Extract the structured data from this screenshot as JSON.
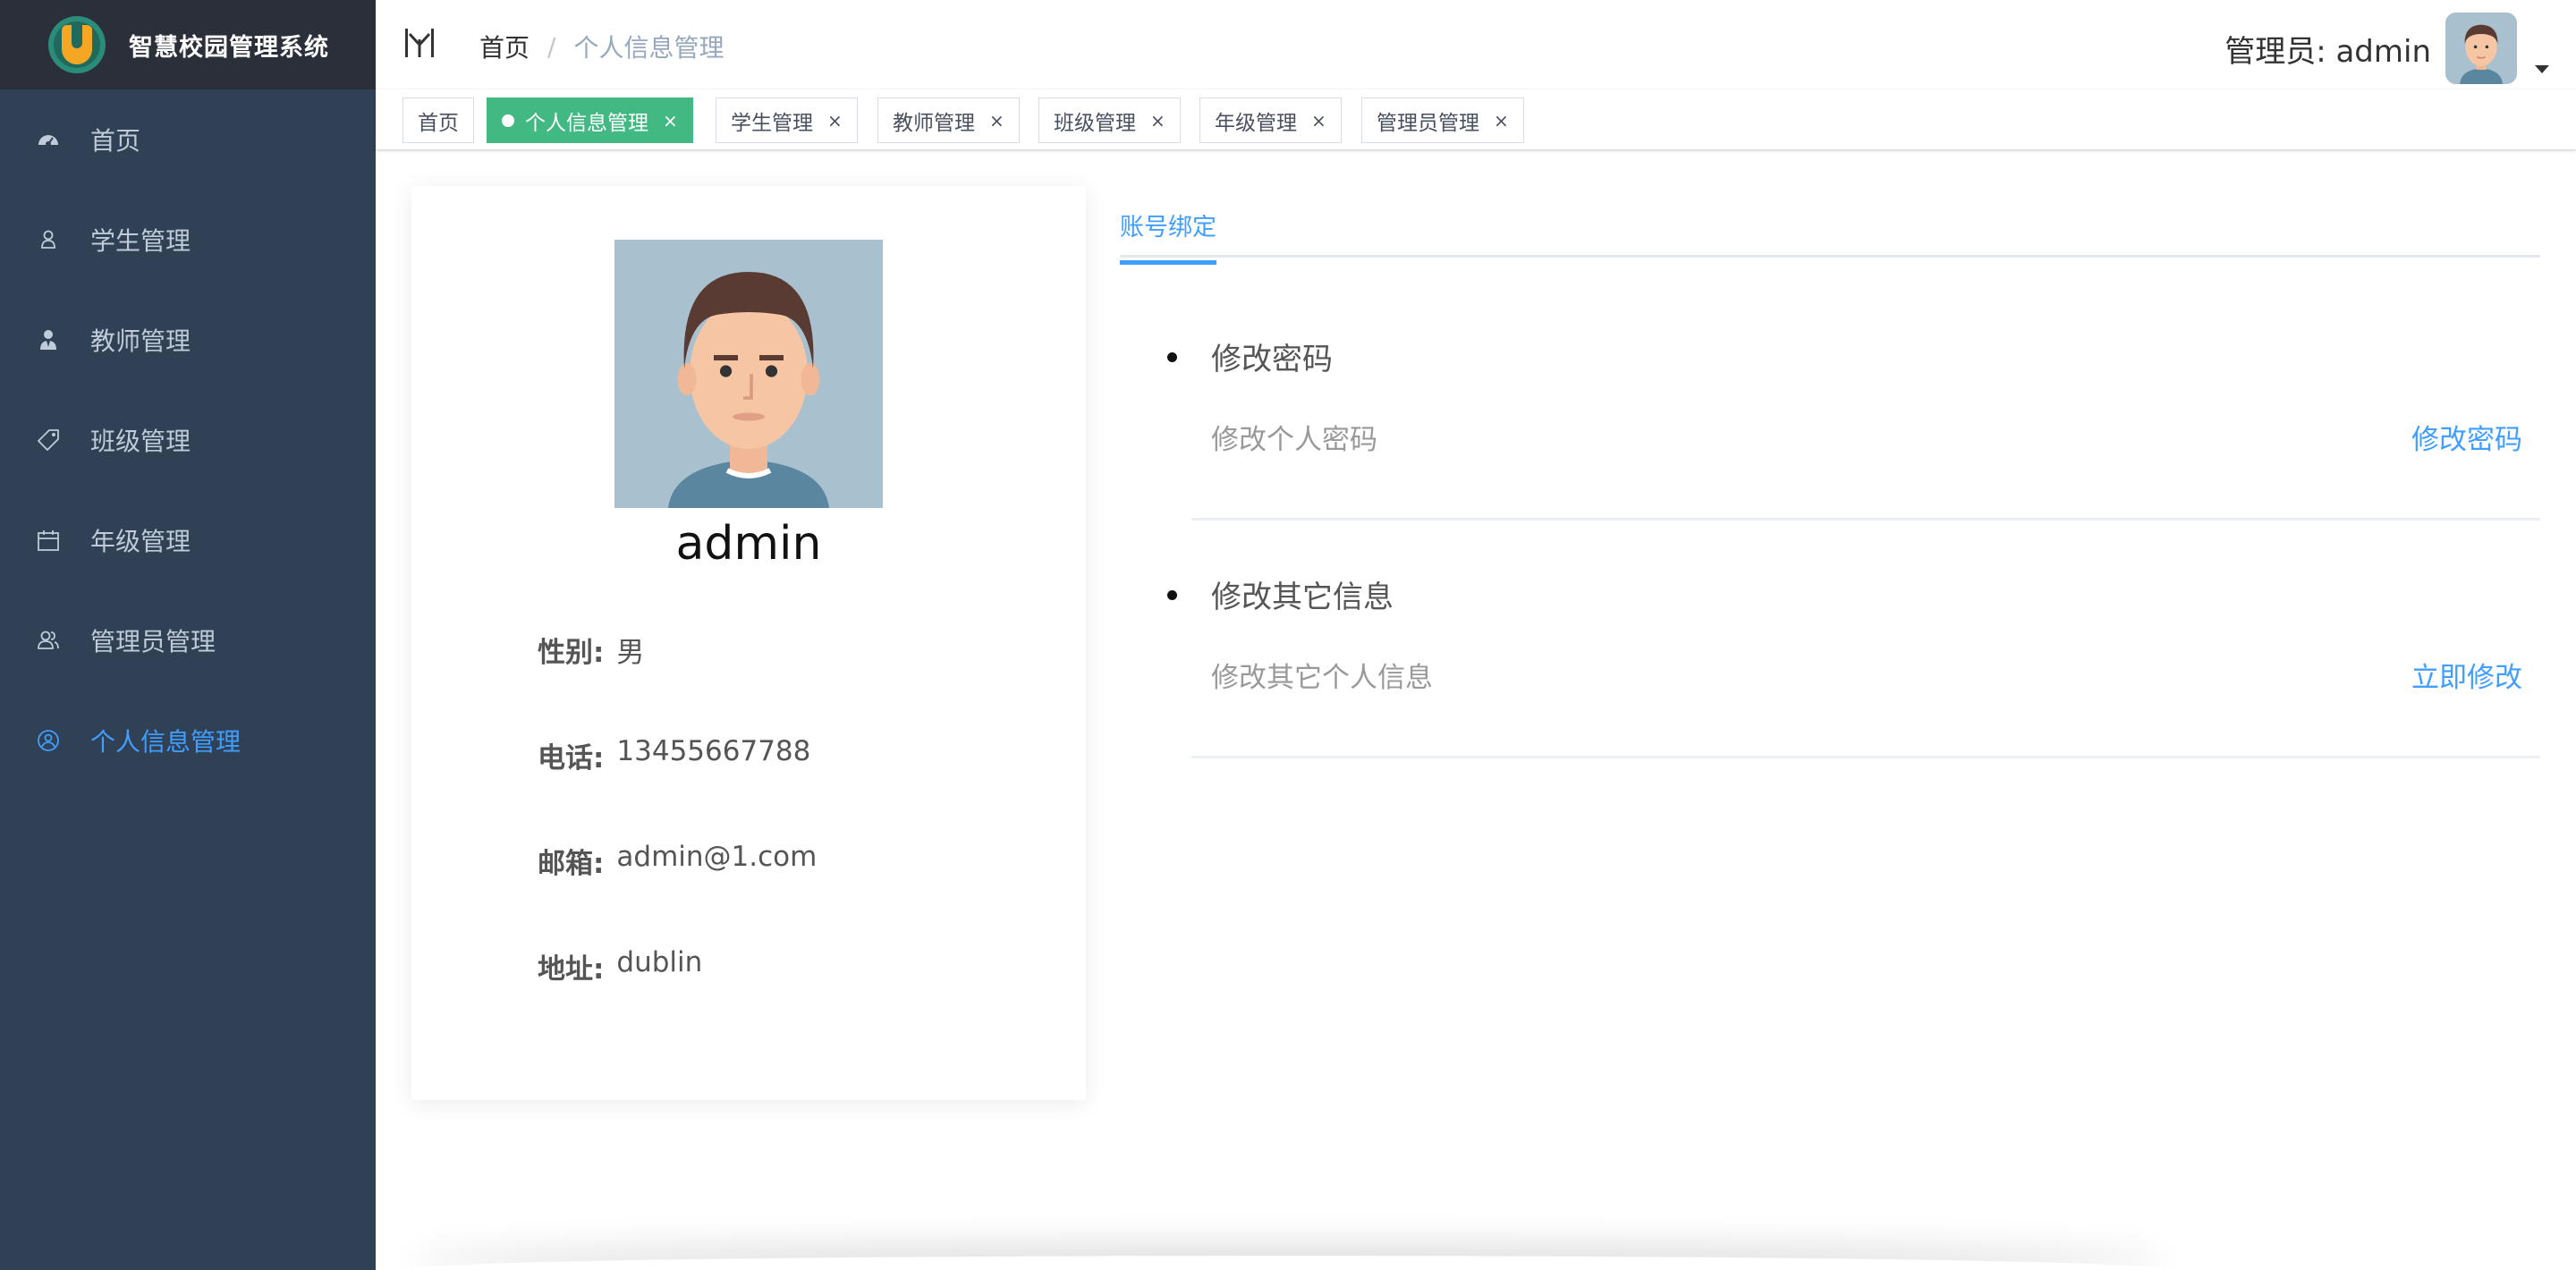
{
  "app": {
    "title": "智慧校园管理系统"
  },
  "sidebar": {
    "items": [
      {
        "label": "首页",
        "icon": "dashboard-icon",
        "active": false
      },
      {
        "label": "学生管理",
        "icon": "user-icon",
        "active": false
      },
      {
        "label": "教师管理",
        "icon": "teacher-icon",
        "active": false
      },
      {
        "label": "班级管理",
        "icon": "tag-icon",
        "active": false
      },
      {
        "label": "年级管理",
        "icon": "calendar-icon",
        "active": false
      },
      {
        "label": "管理员管理",
        "icon": "peoples-icon",
        "active": false
      },
      {
        "label": "个人信息管理",
        "icon": "user-circle-icon",
        "active": true
      }
    ]
  },
  "header": {
    "breadcrumb": [
      "首页",
      "/",
      "个人信息管理"
    ],
    "user_label": "管理员: admin"
  },
  "tags": [
    {
      "label": "首页",
      "active": false,
      "closable": false
    },
    {
      "label": "个人信息管理",
      "active": true,
      "closable": true
    },
    {
      "label": "学生管理",
      "active": false,
      "closable": true
    },
    {
      "label": "教师管理",
      "active": false,
      "closable": true
    },
    {
      "label": "班级管理",
      "active": false,
      "closable": true
    },
    {
      "label": "年级管理",
      "active": false,
      "closable": true
    },
    {
      "label": "管理员管理",
      "active": false,
      "closable": true
    }
  ],
  "tag_close_glyph": "×",
  "profile": {
    "name": "admin",
    "fields": [
      {
        "key": "性别:",
        "value": "男"
      },
      {
        "key": "电话:",
        "value": "13455667788"
      },
      {
        "key": "邮箱:",
        "value": "admin@1.com"
      },
      {
        "key": "地址:",
        "value": "dublin"
      }
    ]
  },
  "settings": {
    "tab_label": "账号绑定",
    "items": [
      {
        "title": "修改密码",
        "description": "修改个人密码",
        "action": "修改密码"
      },
      {
        "title": "修改其它信息",
        "description": "修改其它个人信息",
        "action": "立即修改"
      }
    ]
  },
  "colors": {
    "sidebar_bg": "#304156",
    "logo_bar_bg": "#2b2f3a",
    "menu_text": "#bfcbd9",
    "accent": "#409eff",
    "tag_active": "#42b983"
  }
}
